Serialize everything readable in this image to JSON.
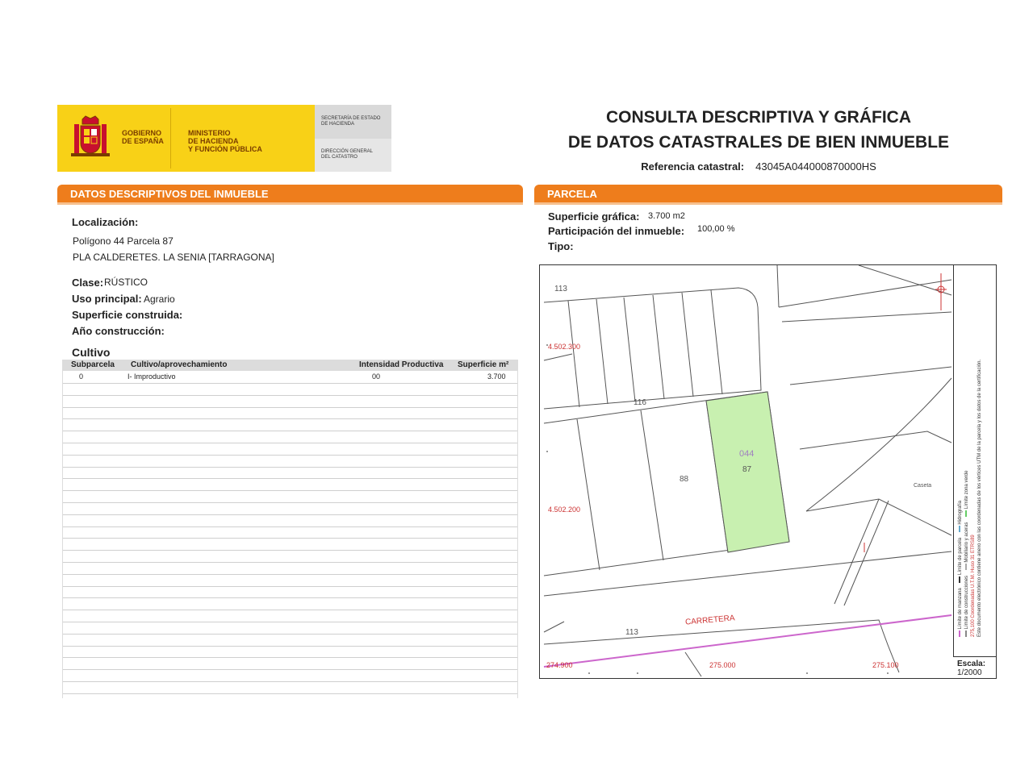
{
  "header": {
    "logo": {
      "gobierno": [
        "GOBIERNO",
        "DE ESPAÑA"
      ],
      "ministerio": [
        "MINISTERIO",
        "DE HACIENDA",
        "Y FUNCIÓN PÚBLICA"
      ],
      "secretaria": [
        "SECRETARÍA DE ESTADO",
        "DE HACIENDA"
      ],
      "direccion": [
        "DIRECCIÓN GENERAL",
        "DEL CATASTRO"
      ]
    },
    "title_line1": "CONSULTA DESCRIPTIVA Y GRÁFICA",
    "title_line2": "DE DATOS CATASTRALES DE BIEN INMUEBLE",
    "ref_label": "Referencia catastral:",
    "ref_value": "43045A044000870000HS"
  },
  "datos": {
    "section_title": "DATOS DESCRIPTIVOS DEL INMUEBLE",
    "localizacion_label": "Localización:",
    "localizacion_line1": "Polígono 44 Parcela 87",
    "localizacion_line2": "PLA CALDERETES. LA SENIA [TARRAGONA]",
    "clase_label": "Clase:",
    "clase_value": "RÚSTICO",
    "uso_label": "Uso principal:",
    "uso_value": "Agrario",
    "superficie_construida_label": "Superficie construida:",
    "anio_label": "Año construcción:",
    "cultivo_label": "Cultivo",
    "table": {
      "headers": [
        "Subparcela",
        "Cultivo/aprovechamiento",
        "Intensidad Productiva",
        "Superficie m²"
      ],
      "rows": [
        [
          "0",
          "I- Improductivo",
          "00",
          "3.700"
        ]
      ]
    }
  },
  "parcela": {
    "section_title": "PARCELA",
    "superficie_label": "Superficie gráfica:",
    "superficie_value": "3.700 m2",
    "participacion_label": "Participación del inmueble:",
    "participacion_value": "100,00 %",
    "tipo_label": "Tipo:"
  },
  "map": {
    "labels": {
      "n113_top": "113",
      "n116": "116",
      "n044": "044",
      "n87": "87",
      "n88": "88",
      "caseta": "Caseta",
      "carretera": "CARRETERA",
      "n113_bottom": "113"
    },
    "coords": {
      "y1": "4.502.300",
      "y2": "4.502.200",
      "x1": "274.900",
      "x2": "275.000",
      "x3": "275.100"
    },
    "legend": {
      "manzana": "Límite de manzana",
      "construcciones": "Límite de construcciones",
      "parcela": "Límite de parcela",
      "mobiliario": "Mobiliario y aceras",
      "hidrografia": "Hidrografía",
      "zona_verde": "Límite zona verde",
      "utm": "275,100 Coordenadas U.T.M. Huso 31 ETRS89",
      "nota": "Este documento electrónico contiene anexo con las coordenadas de los vértices UTM de la parcela y los datos de la certificación."
    },
    "escala_label": "Escala:",
    "escala_value": "1/2000"
  },
  "colors": {
    "orange": "#ee7d1c",
    "yellow": "#f8d117",
    "parcel_fill": "#c8f0b0",
    "pink": "#cc66cc"
  }
}
